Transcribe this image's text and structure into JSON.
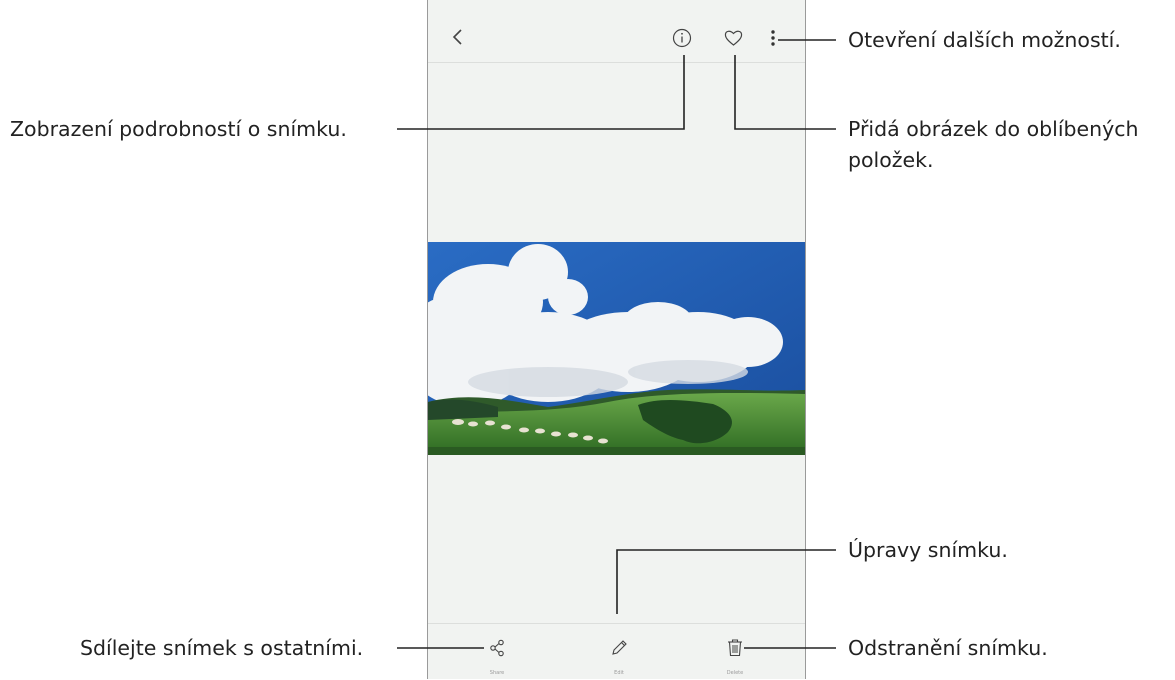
{
  "top_bar": {
    "back_icon": "chevron-left-icon",
    "details_icon": "info-icon",
    "favorite_icon": "heart-icon",
    "more_icon": "more-vertical-icon"
  },
  "bottom_bar": {
    "share_label": "Share",
    "edit_label": "Edit",
    "delete_label": "Delete"
  },
  "callouts": {
    "more_options": "Otevření dalších možností.",
    "details": "Zobrazení podrobností o snímku.",
    "favorite_line1": "Přidá obrázek do oblíbených",
    "favorite_line2": "položek.",
    "edit": "Úpravy snímku.",
    "share": "Sdílejte snímek s ostatními.",
    "delete": "Odstranění snímku."
  },
  "colors": {
    "screen_bg": "#f1f3f1",
    "sky": "#1f5fb5",
    "grass": "#3a8a2e",
    "line": "#222222"
  }
}
